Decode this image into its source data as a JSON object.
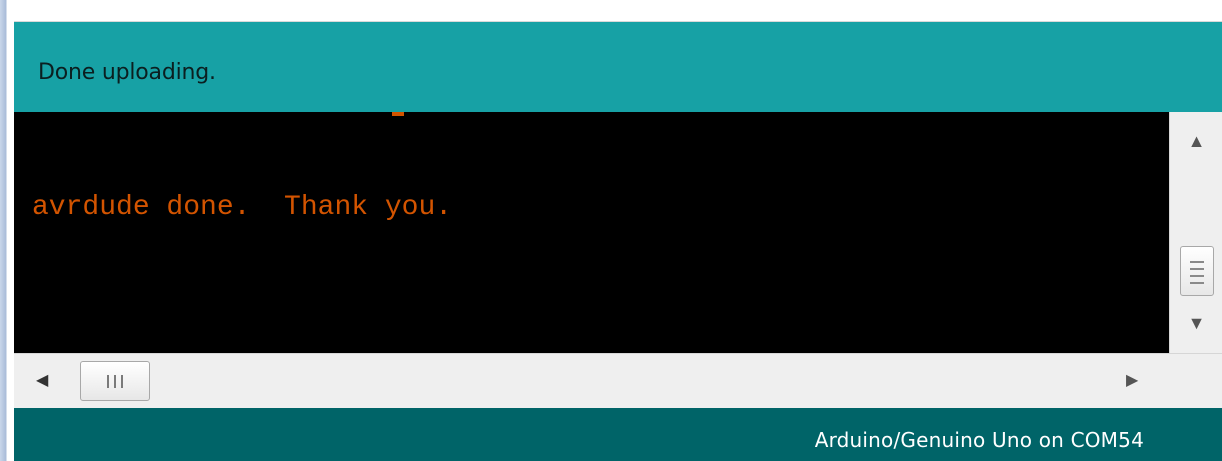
{
  "status": {
    "message": "Done uploading."
  },
  "console": {
    "lines": [
      "avrdude done.  Thank you."
    ],
    "text_color": "#d35400",
    "background": "#000000"
  },
  "footer": {
    "board_info": "Arduino/Genuino Uno on COM54"
  },
  "colors": {
    "status_bar": "#17a1a5",
    "footer_bar": "#006468"
  },
  "icons": {
    "scroll_up": "up-arrow-icon",
    "scroll_down": "down-arrow-icon",
    "scroll_left": "left-arrow-icon",
    "scroll_right": "right-arrow-icon"
  }
}
